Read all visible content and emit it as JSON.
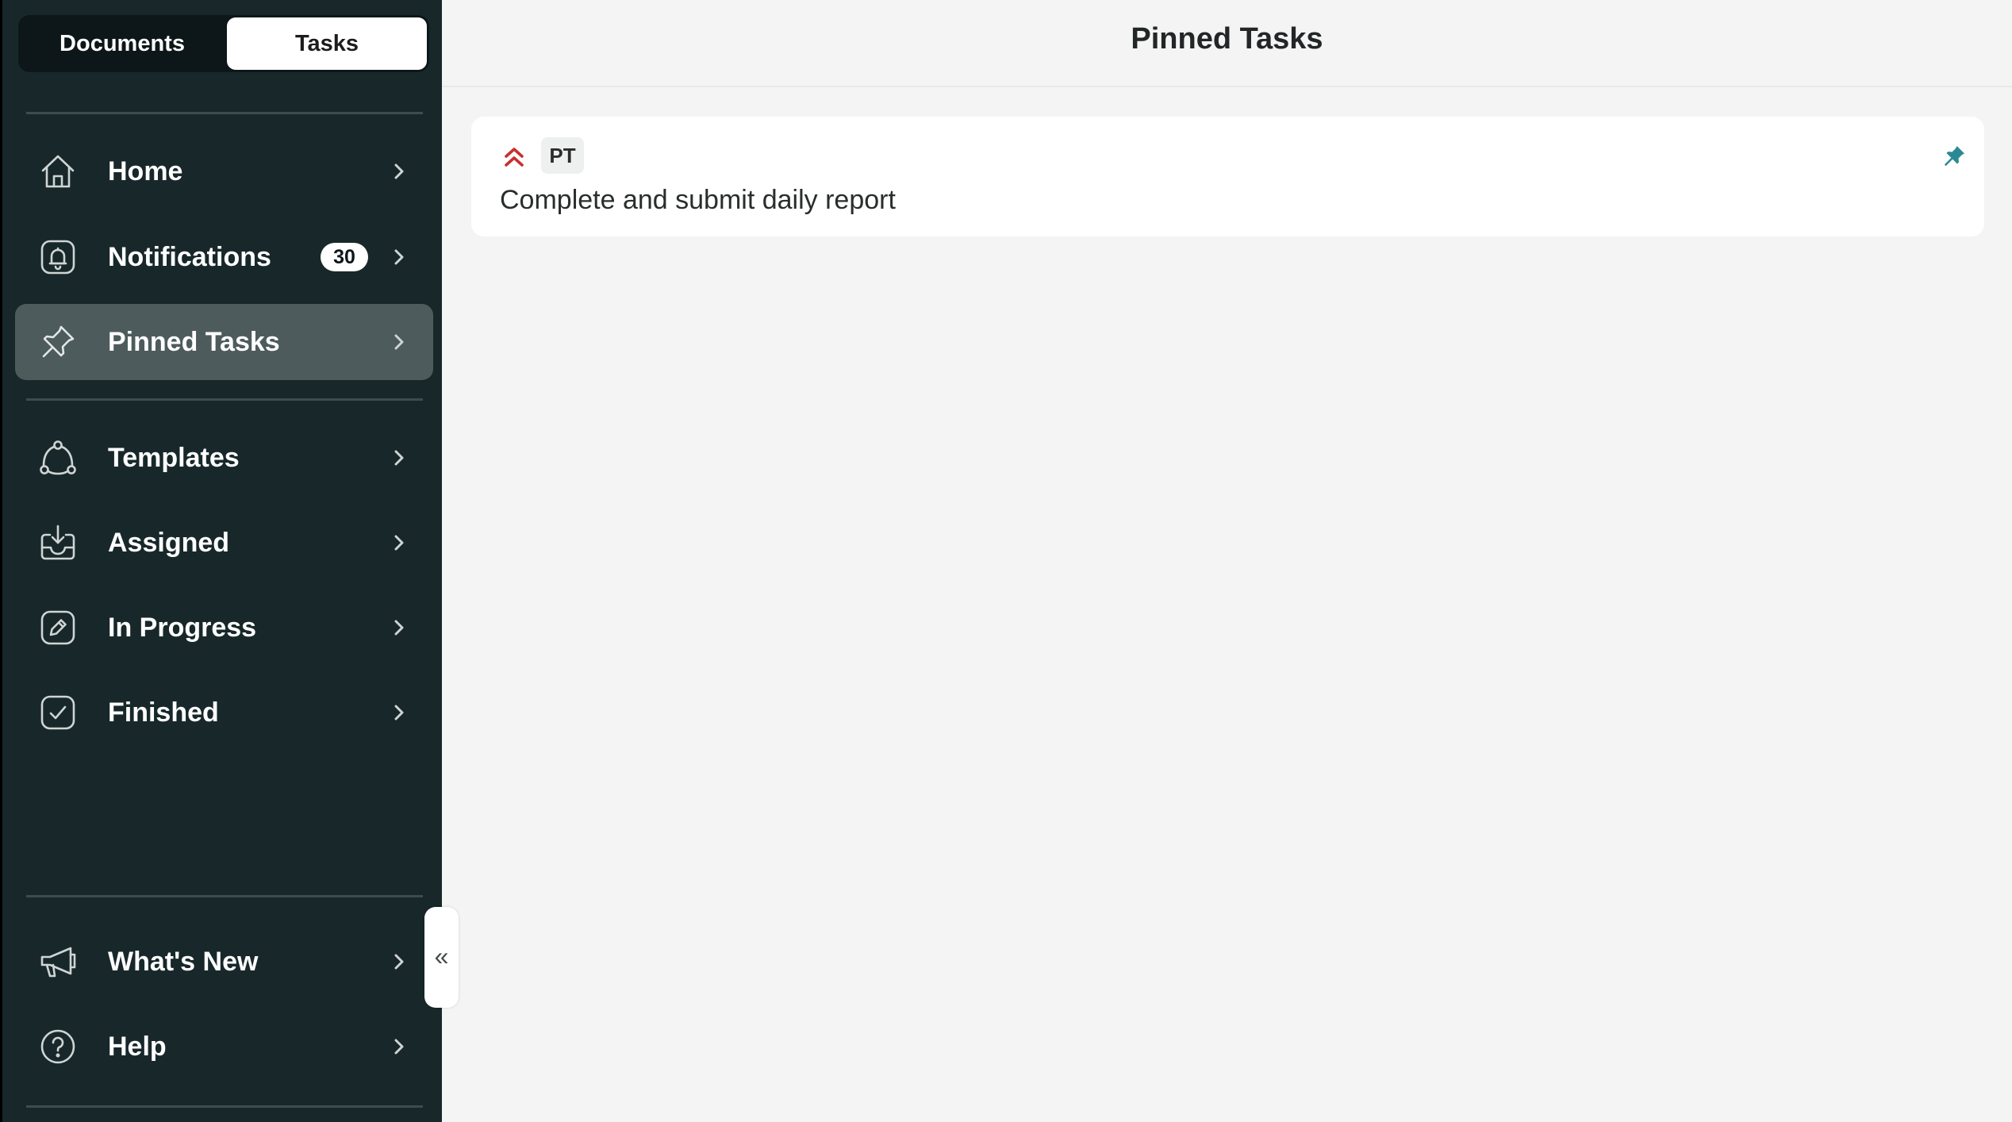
{
  "sidebar": {
    "segment": {
      "documents_label": "Documents",
      "tasks_label": "Tasks",
      "selected": "Tasks"
    },
    "items": [
      {
        "label": "Home",
        "icon": "home-icon"
      },
      {
        "label": "Notifications",
        "icon": "bell-icon",
        "badge": "30"
      },
      {
        "label": "Pinned Tasks",
        "icon": "pin-icon",
        "active": true
      },
      {
        "label": "Templates",
        "icon": "templates-icon"
      },
      {
        "label": "Assigned",
        "icon": "inbox-download-icon"
      },
      {
        "label": "In Progress",
        "icon": "edit-icon"
      },
      {
        "label": "Finished",
        "icon": "check-icon"
      },
      {
        "label": "What's New",
        "icon": "megaphone-icon"
      },
      {
        "label": "Help",
        "icon": "help-icon"
      }
    ],
    "collapse_glyph": "«"
  },
  "main": {
    "title": "Pinned Tasks",
    "tasks": [
      {
        "tag": "PT",
        "title": "Complete and submit daily report",
        "priority": "high",
        "pinned": true
      }
    ]
  },
  "colors": {
    "sidebar_bg": "#18282a",
    "sidebar_active": "#4d5b5d",
    "main_bg": "#f3f4f3",
    "priority_red": "#c8302e",
    "pin_teal": "#2a8a94"
  }
}
